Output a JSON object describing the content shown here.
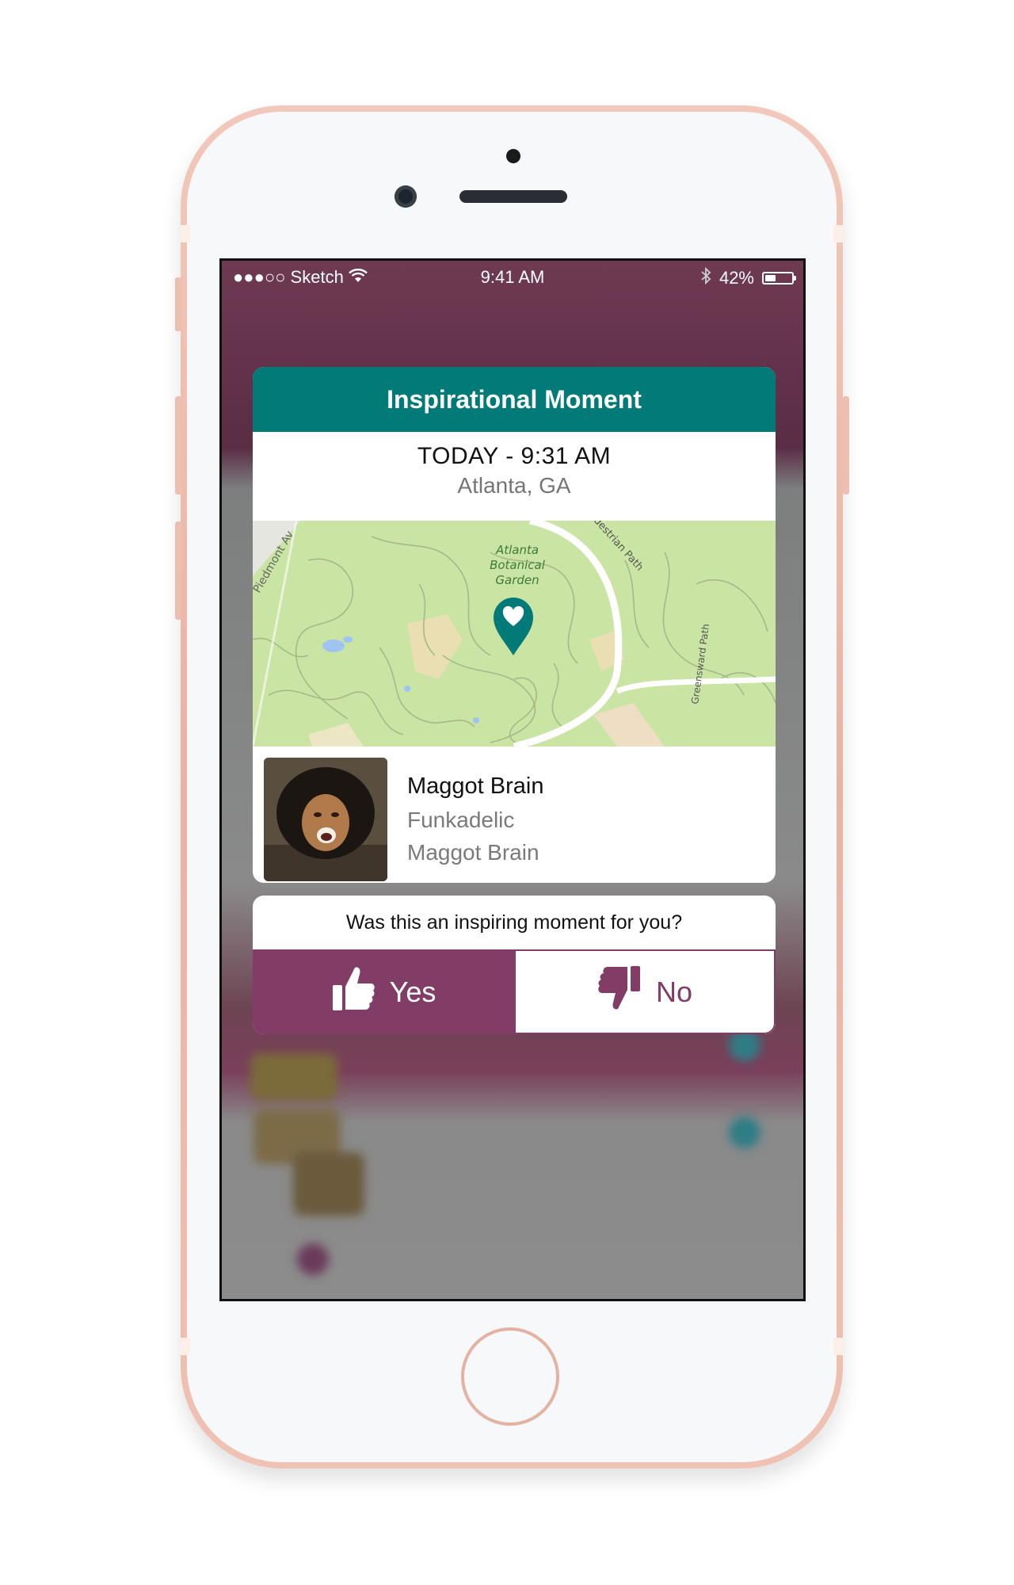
{
  "status_bar": {
    "carrier": "●●●○○ Sketch",
    "time": "9:41 AM",
    "battery_percent": "42%",
    "battery_level": 0.42
  },
  "moment": {
    "header": "Inspirational Moment",
    "when": "TODAY - 9:31 AM",
    "where": "Atlanta, GA"
  },
  "map": {
    "labels": {
      "garden_line1": "Atlanta",
      "garden_line2": "Botanical",
      "garden_line3": "Garden",
      "street_piedmont": "Piedmont Av",
      "street_pedestrian": "destrian Path",
      "street_greensward": "Greensward Path"
    },
    "pin_icon": "heart-pin-icon",
    "colors": {
      "park": "#c9e4a3",
      "pin": "#027a78"
    }
  },
  "track": {
    "title": "Maggot Brain",
    "artist": "Funkadelic",
    "album": "Maggot Brain"
  },
  "feedback": {
    "question": "Was this an inspiring moment for you?",
    "yes_label": "Yes",
    "no_label": "No",
    "yes_icon": "thumbs-up-icon",
    "no_icon": "thumbs-down-icon"
  },
  "colors": {
    "header_teal": "#027a78",
    "accent_plum": "#823d66"
  }
}
